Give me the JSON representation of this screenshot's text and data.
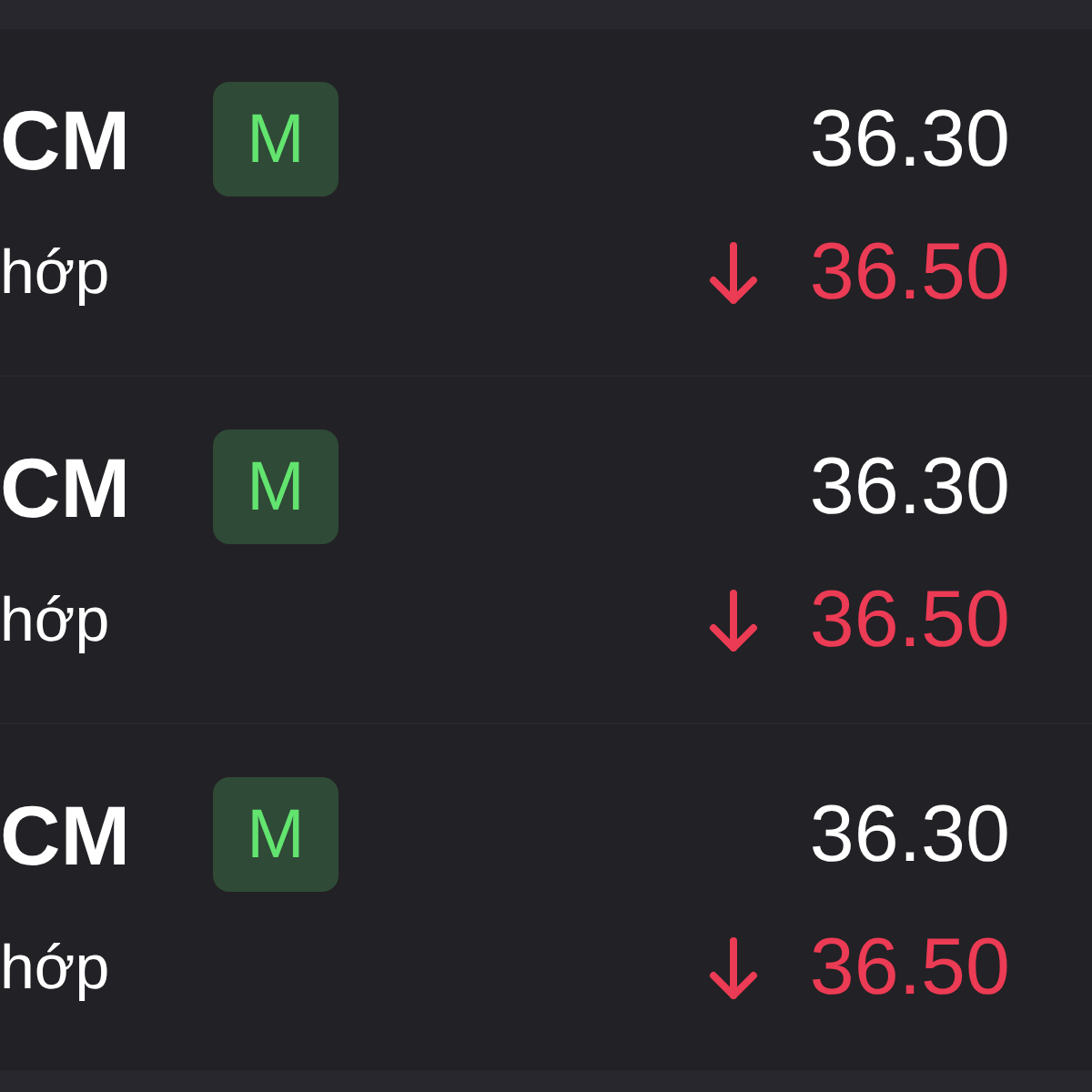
{
  "rows": [
    {
      "symbol": "CM",
      "exchange_badge": "M",
      "price": "36.30",
      "label": "hớp",
      "price_down": true,
      "match_price": "36.50"
    },
    {
      "symbol": "CM",
      "exchange_badge": "M",
      "price": "36.30",
      "label": "hớp",
      "price_down": true,
      "match_price": "36.50"
    },
    {
      "symbol": "CM",
      "exchange_badge": "M",
      "price": "36.30",
      "label": "hớp",
      "price_down": true,
      "match_price": "36.50"
    }
  ]
}
